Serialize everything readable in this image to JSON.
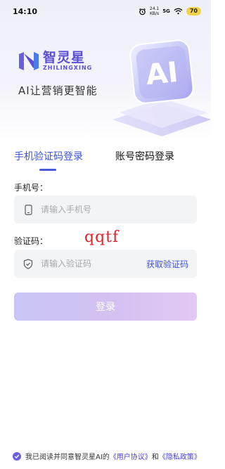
{
  "status_bar": {
    "time": "14:10",
    "speed_value": "24.1",
    "speed_unit": "KB/s",
    "network": "5G",
    "battery": "70"
  },
  "brand": {
    "name_cn": "智灵星",
    "name_en": "ZHILINGXING",
    "tagline": "AI让营销更智能",
    "hero_badge": "AI",
    "color": "#5b4fd4"
  },
  "tabs": {
    "sms_login": "手机验证码登录",
    "password_login": "账号密码登录",
    "active": "sms_login",
    "active_color": "#3d53d8"
  },
  "form": {
    "phone_label": "手机号：",
    "phone_placeholder": "请输入手机号",
    "code_label": "验证码：",
    "code_placeholder": "请输入验证码",
    "get_code": "获取验证码",
    "submit": "登录"
  },
  "overlay_text": "qqtf",
  "agreement": {
    "checked": true,
    "prefix": "我已阅读并同意智灵星AI的",
    "user_agreement": "《用户协议》",
    "middle": "和",
    "privacy_policy": "《隐私政策》"
  },
  "icons": {
    "phone": "phone-icon",
    "shield": "shield-check-icon",
    "check": "check-icon",
    "alarm": "alarm-icon",
    "wifi": "wifi-icon"
  }
}
